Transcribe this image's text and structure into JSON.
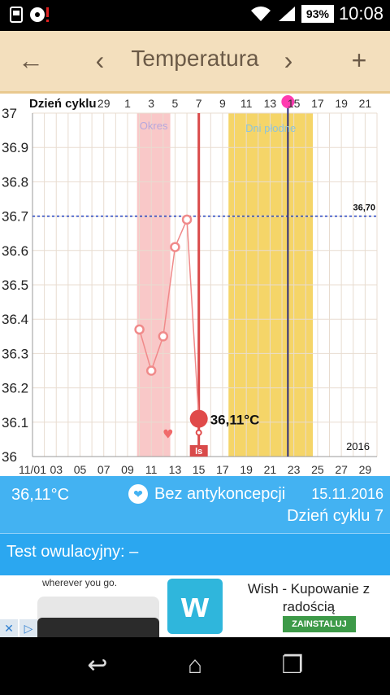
{
  "status_bar": {
    "time": "10:08",
    "battery": "93%",
    "icons": [
      "app-notification-icon",
      "alert-icon",
      "wifi-icon",
      "signal-icon",
      "battery-icon"
    ]
  },
  "toolbar": {
    "back_icon": "←",
    "prev_icon": "‹",
    "title": "Temperatura",
    "next_icon": "›",
    "add_icon": "+",
    "background": "#f3dfbd"
  },
  "chart_data": {
    "type": "line",
    "cycle_label": "Dzień cyklu",
    "cycle_ticks": [
      "29",
      "1",
      "3",
      "5",
      "7",
      "9",
      "11",
      "13",
      "15",
      "17",
      "19",
      "21"
    ],
    "date_ticks": [
      "11/01",
      "03",
      "05",
      "07",
      "09",
      "11",
      "13",
      "15",
      "17",
      "19",
      "21",
      "23",
      "25",
      "27",
      "29"
    ],
    "y_ticks": [
      "37",
      "36.9",
      "36.8",
      "36.7",
      "36.6",
      "36.5",
      "36.4",
      "36.3",
      "36.2",
      "36.1",
      "36"
    ],
    "ylim": [
      36.0,
      37.0
    ],
    "x_dates": [
      1,
      30
    ],
    "series": [
      {
        "x": [
          10,
          11,
          12,
          13,
          14
        ],
        "values": [
          36.37,
          36.25,
          36.35,
          36.61,
          36.69
        ],
        "color": "#f08a8a"
      }
    ],
    "current_point": {
      "x": 15,
      "value": 36.11,
      "label": "36,11°C",
      "color": "#e04a4a"
    },
    "reference_line": {
      "value": 36.7,
      "label": "36,70",
      "color": "#1f3fbf"
    },
    "period_band": {
      "x_start": 9.8,
      "x_end": 12.6,
      "label": "Okres",
      "color": "#f9c8c8"
    },
    "fertile_band": {
      "x_start": 17.5,
      "x_end": 24.6,
      "label": "Dni płodne",
      "color": "#f5d568"
    },
    "today_line_x": 15,
    "ovulation_line_x": 22.5,
    "heart_x": 12.4,
    "intercourse_marker": {
      "x": 15,
      "label": "ls"
    },
    "year_label": "2016",
    "grid": true
  },
  "info": {
    "temperature": "36,11°C",
    "contraception": "Bez antykoncepcji",
    "date": "15.11.2016",
    "cycle_day": "Dzień cyklu 7",
    "background": "#43b2f2"
  },
  "ovulation_test": "Test owulacyjny: –",
  "ad": {
    "tagline": "wherever you go.",
    "app_name": "Wish - Kupowanie z radością",
    "install_label": "ZAINSTALUJ",
    "logo_letter": "w"
  },
  "nav": {
    "back": "↩",
    "home": "⌂",
    "recents": "❐"
  }
}
